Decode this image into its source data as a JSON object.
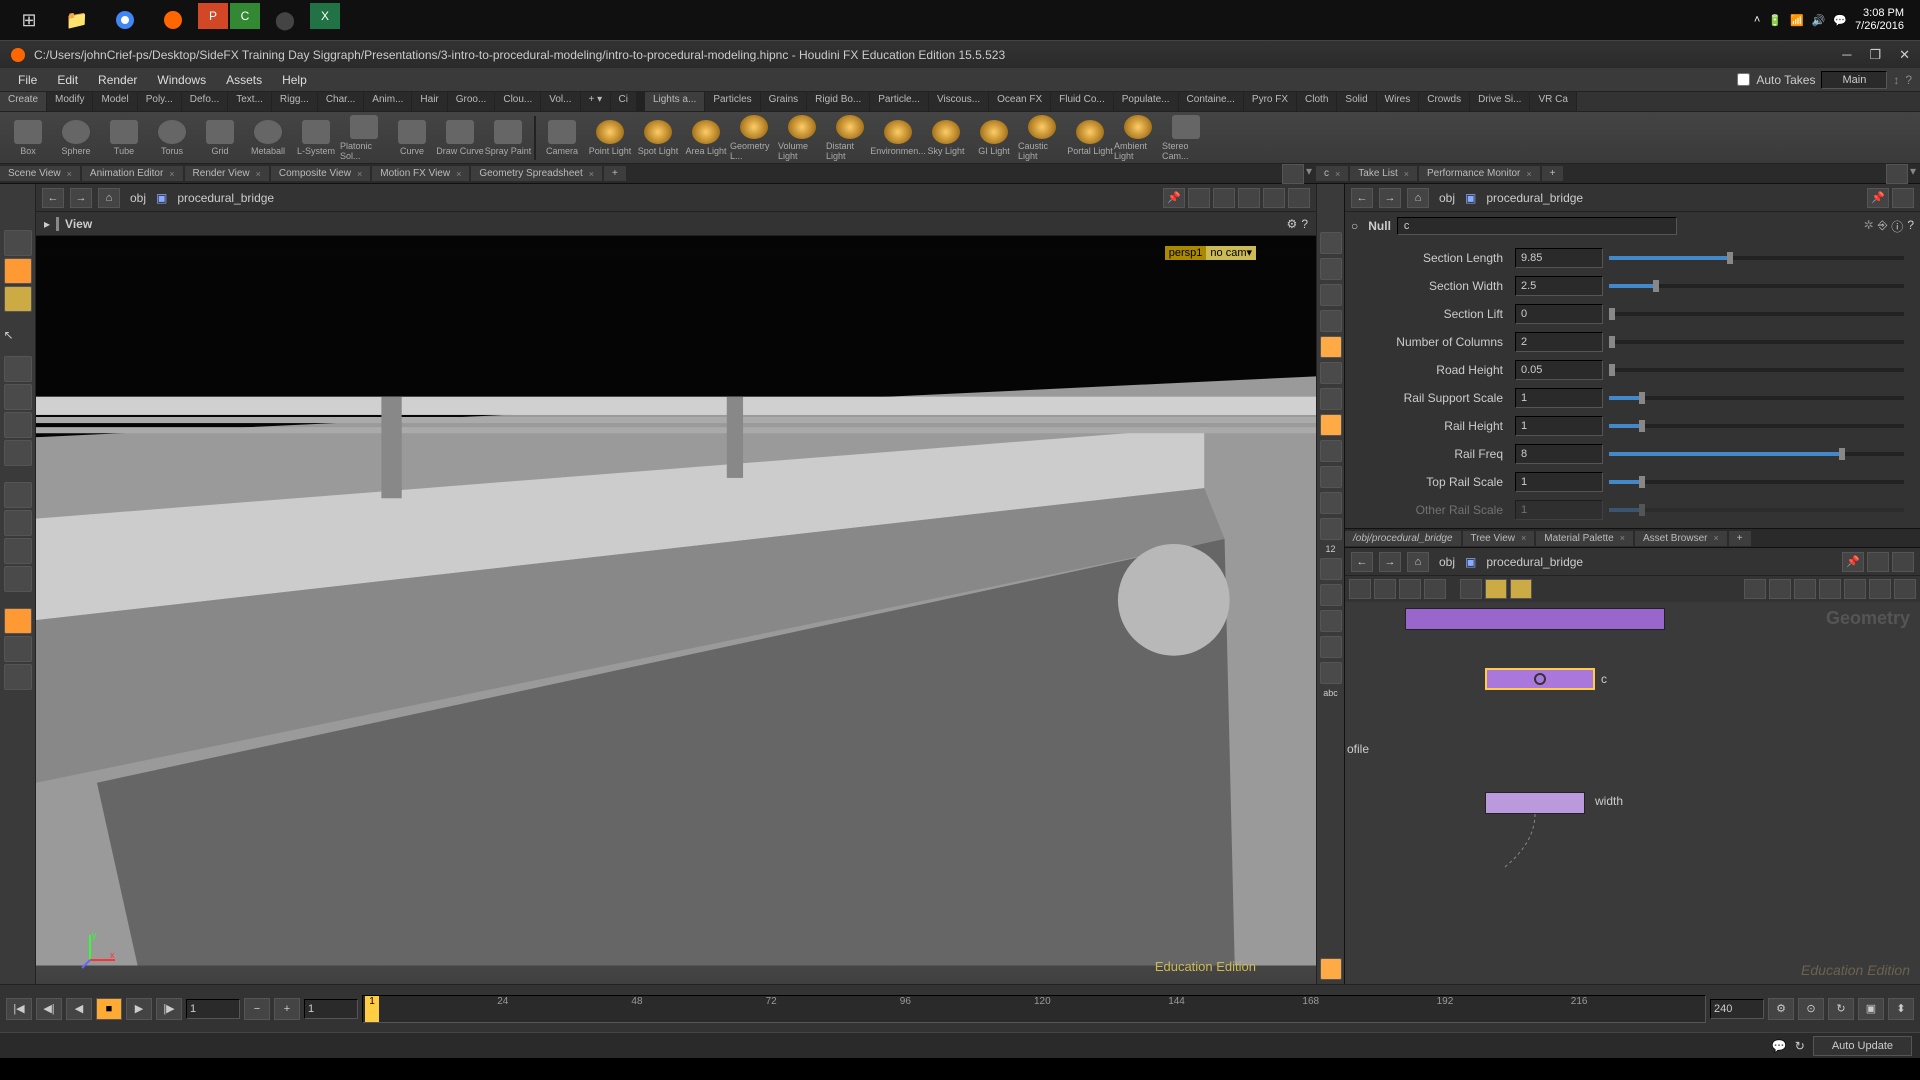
{
  "taskbar": {
    "time": "3:08 PM",
    "date": "7/26/2016"
  },
  "titlebar": {
    "text": "C:/Users/johnCrief-ps/Desktop/SideFX Training Day Siggraph/Presentations/3-intro-to-procedural-modeling/intro-to-procedural-modeling.hipnc - Houdini FX Education Edition 15.5.523"
  },
  "menu": {
    "file": "File",
    "edit": "Edit",
    "render": "Render",
    "windows": "Windows",
    "assets": "Assets",
    "help": "Help",
    "auto_takes": "Auto Takes",
    "main": "Main"
  },
  "shelf_tabs": {
    "create": "Create",
    "modify": "Modify",
    "model": "Model",
    "poly": "Poly...",
    "defo": "Defo...",
    "text": "Text...",
    "rigg": "Rigg...",
    "char": "Char...",
    "anim": "Anim...",
    "hair": "Hair",
    "groo": "Groo...",
    "clou": "Clou...",
    "vol": "Vol...",
    "ci": "Ci",
    "lights": "Lights a...",
    "particles": "Particles",
    "grains": "Grains",
    "rigid": "Rigid Bo...",
    "particle": "Particle...",
    "viscous": "Viscous...",
    "ocean": "Ocean FX",
    "fluid": "Fluid Co...",
    "populate": "Populate...",
    "containe": "Containe...",
    "pyro": "Pyro FX",
    "cloth": "Cloth",
    "solid": "Solid",
    "wires": "Wires",
    "crowds": "Crowds",
    "drive": "Drive Si...",
    "vr": "VR Ca"
  },
  "shelf_tools": {
    "box": "Box",
    "sphere": "Sphere",
    "tube": "Tube",
    "torus": "Torus",
    "grid": "Grid",
    "metaball": "Metaball",
    "lsystem": "L-System",
    "platonic": "Platonic Sol...",
    "curve": "Curve",
    "drawcurve": "Draw Curve",
    "spraypaint": "Spray Paint",
    "camera": "Camera",
    "pointlight": "Point Light",
    "spotlight": "Spot Light",
    "arealight": "Area Light",
    "geolight": "Geometry L...",
    "vollight": "Volume Light",
    "distlight": "Distant Light",
    "envlight": "Environmen...",
    "skylight": "Sky Light",
    "gilight": "GI Light",
    "caustic": "Caustic Light",
    "portal": "Portal Light",
    "ambient": "Ambient Light",
    "stereo": "Stereo Cam..."
  },
  "pane_tabs": {
    "scene": "Scene View",
    "anim": "Animation Editor",
    "render": "Render View",
    "composite": "Composite View",
    "motion": "Motion FX View",
    "geo": "Geometry Spreadsheet",
    "c": "c",
    "take": "Take List",
    "perf": "Performance Monitor",
    "obj_proc": "/obj/procedural_bridge",
    "tree": "Tree View",
    "material": "Material Palette",
    "asset": "Asset Browser"
  },
  "path": {
    "obj": "obj",
    "node": "procedural_bridge"
  },
  "viewport": {
    "view": "View",
    "persp": "persp1",
    "nocam": "no cam▾",
    "edu": "Education Edition"
  },
  "node": {
    "type": "Null",
    "name": "c"
  },
  "params": [
    {
      "label": "Section Length",
      "value": "9.85",
      "fill": 40,
      "thumb": 40
    },
    {
      "label": "Section Width",
      "value": "2.5",
      "fill": 15,
      "thumb": 15
    },
    {
      "label": "Section Lift",
      "value": "0",
      "fill": 0,
      "thumb": 0
    },
    {
      "label": "Number of Columns",
      "value": "2",
      "fill": 0,
      "thumb": 0
    },
    {
      "label": "Road Height",
      "value": "0.05",
      "fill": 0,
      "thumb": 0
    },
    {
      "label": "Rail Support Scale",
      "value": "1",
      "fill": 10,
      "thumb": 10
    },
    {
      "label": "Rail Height",
      "value": "1",
      "fill": 10,
      "thumb": 10
    },
    {
      "label": "Rail Freq",
      "value": "8",
      "fill": 78,
      "thumb": 78
    },
    {
      "label": "Top Rail Scale",
      "value": "1",
      "fill": 10,
      "thumb": 10
    },
    {
      "label": "Other Rail Scale",
      "value": "1",
      "fill": 10,
      "thumb": 10
    }
  ],
  "network": {
    "geometry": "Geometry",
    "c_label": "c",
    "width_label": "width",
    "ofile": "ofile",
    "edu": "Education Edition"
  },
  "timeline": {
    "start": "1",
    "end": "240",
    "current": "1",
    "ticks": [
      "24",
      "48",
      "72",
      "96",
      "120",
      "144",
      "168",
      "192",
      "216"
    ]
  },
  "status": {
    "auto_update": "Auto Update"
  }
}
